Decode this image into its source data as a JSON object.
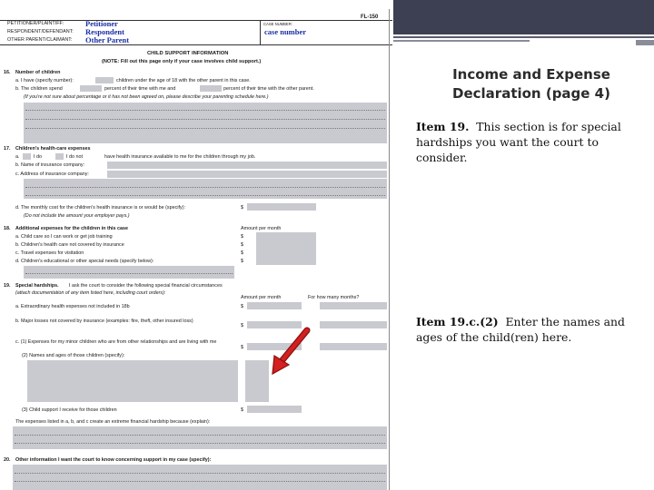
{
  "slide": {
    "title": "Income and Expense Declaration (page 4)",
    "item19_label": "Item 19.",
    "item19_text": "This section is for special hardships you want the court to consider.",
    "item19c_label": "Item 19.c.(2)",
    "item19c_text": "Enter the names and ages of the child(ren) here."
  },
  "form": {
    "form_number": "FL-150",
    "header": {
      "petitioner_label": "PETITIONER/PLAINTIFF:",
      "respondent_label": "RESPONDENT/DEFENDANT:",
      "other_label": "OTHER PARENT/CLAIMANT:",
      "petitioner_value": "Petitioner",
      "respondent_value": "Respondent",
      "other_value": "Other Parent",
      "case_number_label": "CASE NUMBER:",
      "case_number_value": "case number"
    },
    "section_title": "CHILD SUPPORT INFORMATION",
    "section_note": "(NOTE: Fill out this page only if your case involves child support.)",
    "item16": {
      "num": "16.",
      "title": "Number of children",
      "a": "a. I have (specify number):",
      "a_tail": "children under the age of 18 with the other parent in this case.",
      "b": "b. The children spend",
      "b_mid": "percent of their time with me and",
      "b_tail": "percent of their time with the other parent.",
      "note": "(If you're not sure about percentage or it has not been agreed on, please describe your parenting schedule here.)"
    },
    "item17": {
      "num": "17.",
      "title": "Children's health-care expenses",
      "a_pre": "a.",
      "a_do": "I do",
      "a_donot": "I do not",
      "a_tail": "have health insurance available to me for the children through my job.",
      "b": "b. Name of insurance company:",
      "c": "c. Address of insurance company:",
      "d": "d. The monthly cost for the children's health insurance is or would be (specify):",
      "d_dollar": "$",
      "d_note": "(Do not include the amount your employer pays.)"
    },
    "item18": {
      "num": "18.",
      "title": "Additional expenses for the children in this case",
      "amount_header": "Amount per month",
      "a": "a. Child care so I can work or get job training",
      "b": "b. Children's health care not covered by insurance",
      "c": "c. Travel expenses for visitation",
      "d": "d. Children's educational or other special needs (specify below):",
      "dollar": "$"
    },
    "item19": {
      "num": "19.",
      "title": "Special hardships.",
      "title_tail": "I ask the court to consider the following special financial circumstances",
      "note": "(attach documentation of any item listed here, including court orders):",
      "amount_header": "Amount per month",
      "months_header": "For how many months?",
      "a": "a. Extraordinary health expenses not included in 18b",
      "b": "b. Major losses not covered by insurance (examples: fire, theft, other insured loss)",
      "c1": "c. (1) Expenses for my minor children who are from other relationships and are living with me",
      "c2": "(2) Names and ages of those children (specify):",
      "c3": "(3) Child support I receive for those children",
      "explain": "The expenses listed in a, b, and c create an extreme financial hardship because (explain):",
      "dollar": "$"
    },
    "item20": {
      "num": "20.",
      "title": "Other information I want the court to know concerning support in my case (specify):"
    }
  },
  "arrow": {
    "color": "#d42020",
    "outline": "#8a1010"
  },
  "colors": {
    "header_band": "#3d3f52",
    "field_gray": "#c9cad0",
    "handwriting_blue": "#1a2ea8"
  }
}
